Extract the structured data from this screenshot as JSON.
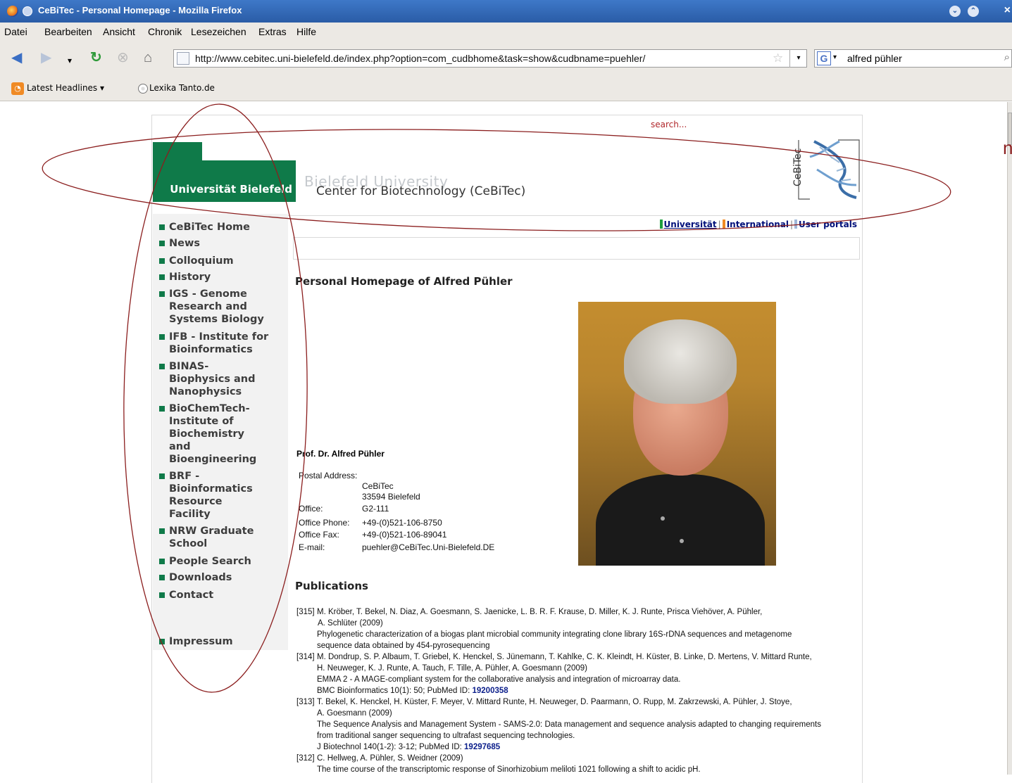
{
  "window": {
    "title": "CeBiTec - Personal Homepage - Mozilla Firefox",
    "btn_min": "⌄",
    "btn_max": "⌃",
    "btn_close": "×"
  },
  "menu": [
    "Datei",
    "Bearbeiten",
    "Ansicht",
    "Chronik",
    "Lesezeichen",
    "Extras",
    "Hilfe"
  ],
  "nav": {
    "url": "http://www.cebitec.uni-bielefeld.de/index.php?option=com_cudbhome&task=show&cudbname=puehler/",
    "search_value": "alfred pühler",
    "search_engine_glyph": "G"
  },
  "bookmarks": {
    "item1": "Latest Headlines ▾",
    "item2": "Lexika Tanto.de"
  },
  "header": {
    "search_link": "search...",
    "logo_green_text": "Universität Bielefeld",
    "university_en": "Bielefeld University",
    "center_name": "Center for Biotechnology (CeBiTec)",
    "logo_vertical": "CeBiTec"
  },
  "topnav": {
    "universitat": "Universität",
    "international": "International",
    "user_portals": "User portals",
    "color_universitat": "#1e9e3e",
    "color_international": "#f08a24",
    "color_user_portals": "#9fb7d9"
  },
  "sidebar": [
    {
      "label": "CeBiTec Home"
    },
    {
      "label": "News"
    },
    {
      "label": "Colloquium"
    },
    {
      "label": "History"
    },
    {
      "label": "IGS - Genome Research and Systems Biology"
    },
    {
      "label": "IFB - Institute for Bioinformatics"
    },
    {
      "label": "BINAS-Biophysics and Nanophysics"
    },
    {
      "label": "BioChemTech-Institute of Biochemistry and Bioengineering"
    },
    {
      "label": "BRF - Bioinformatics Resource Facility"
    },
    {
      "label": "NRW Graduate School"
    },
    {
      "label": "People Search"
    },
    {
      "label": "Downloads"
    },
    {
      "label": "Contact"
    },
    {
      "label": "Impressum"
    }
  ],
  "main": {
    "heading": "Personal Homepage of Alfred Pühler",
    "name": "Prof. Dr. Alfred Pühler",
    "postal_label": "Postal Address:",
    "postal_line1": "CeBiTec",
    "postal_line2": "33594 Bielefeld",
    "office_label": "Office:",
    "office_value": "G2-111",
    "phone_label": "Office Phone:",
    "phone_value": "+49-(0)521-106-8750",
    "fax_label": "Office Fax:",
    "fax_value": "+49-(0)521-106-89041",
    "email_label": "E-mail:",
    "email_value": "puehler@CeBiTec.Uni-Bielefeld.DE",
    "publications_heading": "Publications"
  },
  "publications": [
    {
      "num": "[315]",
      "authors1": "M. Kröber, T. Bekel, N. Diaz, A. Goesmann, S. Jaenicke, L. B. R. F. Krause, D. Miller, K. J. Runte, Prisca Viehöver, A. Pühler,",
      "authors2": "A. Schlüter (2009)",
      "title1": "Phylogenetic characterization of a biogas plant microbial community integrating clone library 16S-rDNA sequences and metagenome",
      "title2": "sequence data obtained by 454-pyrosequencing"
    },
    {
      "num": "[314]",
      "authors1": "M. Dondrup, S. P. Albaum, T. Griebel, K. Henckel, S. Jünemann, T. Kahlke, C. K. Kleindt, H. Küster, B. Linke, D. Mertens, V. Mittard Runte,",
      "authors2": "H. Neuweger, K. J. Runte, A. Tauch, F. Tille, A. Pühler, A. Goesmann (2009)",
      "title1": "EMMA 2 - A MAGE-compliant system for the collaborative analysis and integration of microarray data.",
      "journal": "BMC Bioinformatics 10(1): 50; PubMed ID: ",
      "pubmed": "19200358"
    },
    {
      "num": "[313]",
      "authors1": "T. Bekel, K. Henckel, H. Küster, F. Meyer, V. Mittard Runte, H. Neuweger, D. Paarmann, O. Rupp, M. Zakrzewski, A. Pühler, J. Stoye,",
      "authors2": "A. Goesmann (2009)",
      "title1": "The Sequence Analysis and Management System - SAMS-2.0: Data management and sequence analysis adapted to changing requirements",
      "title2": "from traditional sanger sequencing to ultrafast sequencing technologies.",
      "journal": "J Biotechnol 140(1-2): 3-12; PubMed ID: ",
      "pubmed": "19297685"
    },
    {
      "num": "[312]",
      "authors1": "C. Hellweg, A. Pühler, S. Weidner (2009)",
      "title1": "The time course of the transcriptomic response of Sinorhizobium meliloti 1021 following a shift to acidic pH."
    }
  ],
  "annotation": {
    "clipped_text": "n",
    "ellipse_color": "#8b1e1e"
  }
}
